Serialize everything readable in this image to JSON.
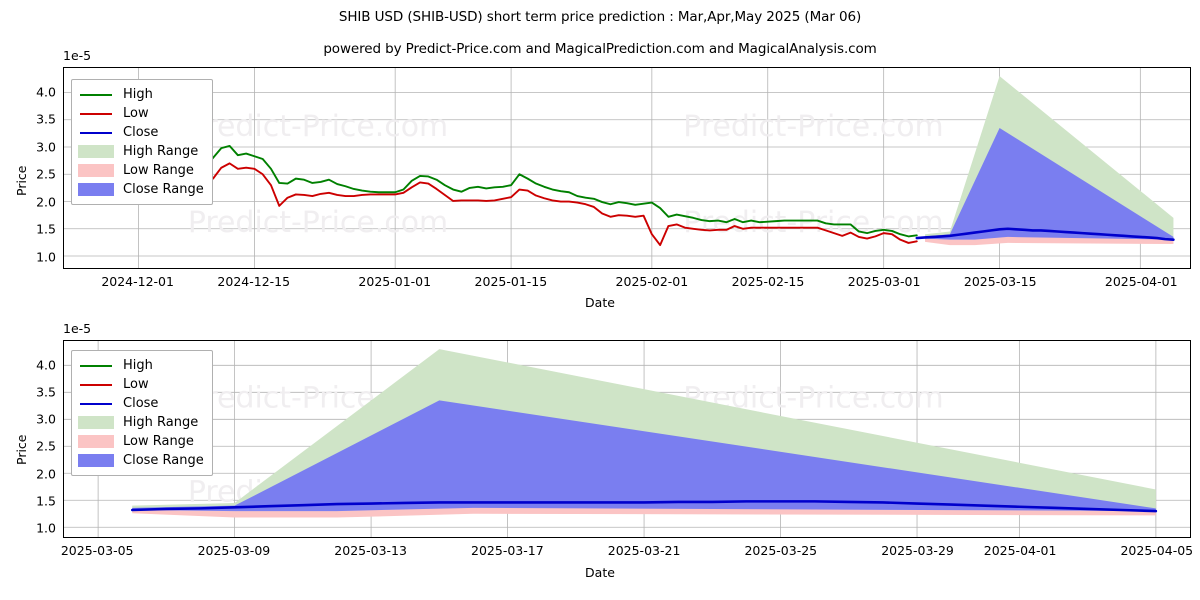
{
  "header": {
    "title": "SHIB USD (SHIB-USD) short term price prediction : Mar,Apr,May 2025 (Mar 06)",
    "subtitle": "powered by Predict-Price.com and MagicalPrediction.com and MagicalAnalysis.com"
  },
  "watermark": {
    "text": "Predict-Price.com"
  },
  "colors": {
    "high_line": "#008000",
    "low_line": "#cc0000",
    "close_line": "#0000cc",
    "high_range": "#cfe4c7",
    "low_range": "#fbc4c4",
    "close_range": "#7a7ef0",
    "grid": "#b4b4b4",
    "frame": "#000000",
    "watermark": "#f0eef0"
  },
  "legend": {
    "items": [
      {
        "label": "High",
        "type": "line",
        "color": "#008000",
        "name": "legend-high"
      },
      {
        "label": "Low",
        "type": "line",
        "color": "#cc0000",
        "name": "legend-low"
      },
      {
        "label": "Close",
        "type": "line",
        "color": "#0000cc",
        "name": "legend-close"
      },
      {
        "label": "High Range",
        "type": "patch",
        "color": "#cfe4c7",
        "name": "legend-high-range"
      },
      {
        "label": "Low Range",
        "type": "patch",
        "color": "#fbc4c4",
        "name": "legend-low-range"
      },
      {
        "label": "Close Range",
        "type": "patch",
        "color": "#7a7ef0",
        "name": "legend-close-range"
      }
    ]
  },
  "chart_data": [
    {
      "id": "top",
      "type": "line",
      "title": "SHIB USD (SHIB-USD) short term price prediction : Mar,Apr,May 2025 (Mar 06)",
      "xlabel": "Date",
      "ylabel": "Price",
      "y_exponent_label": "1e-5",
      "y_scale": 1e-05,
      "ylim": [
        0.78,
        4.45
      ],
      "yticks": [
        1.0,
        1.5,
        2.0,
        2.5,
        3.0,
        3.5,
        4.0
      ],
      "ytick_labels": [
        "1.0",
        "1.5",
        "2.0",
        "2.5",
        "3.0",
        "3.5",
        "4.0"
      ],
      "xlim": [
        "2024-11-22",
        "2025-04-07"
      ],
      "xticks": [
        "2024-12-01",
        "2024-12-15",
        "2025-01-01",
        "2025-01-15",
        "2025-02-01",
        "2025-02-15",
        "2025-03-01",
        "2025-03-15",
        "2025-04-01"
      ],
      "grid": true,
      "legend_position": "upper left",
      "series": [
        {
          "name": "High",
          "color": "#008000",
          "x": [
            "2024-11-25",
            "2024-11-26",
            "2024-11-27",
            "2024-11-28",
            "2024-11-29",
            "2024-11-30",
            "2024-12-01",
            "2024-12-02",
            "2024-12-03",
            "2024-12-04",
            "2024-12-05",
            "2024-12-06",
            "2024-12-07",
            "2024-12-08",
            "2024-12-09",
            "2024-12-10",
            "2024-12-11",
            "2024-12-12",
            "2024-12-13",
            "2024-12-14",
            "2024-12-15",
            "2024-12-16",
            "2024-12-17",
            "2024-12-18",
            "2024-12-19",
            "2024-12-20",
            "2024-12-21",
            "2024-12-22",
            "2024-12-23",
            "2024-12-24",
            "2024-12-25",
            "2024-12-26",
            "2024-12-27",
            "2024-12-28",
            "2024-12-29",
            "2024-12-30",
            "2024-12-31",
            "2025-01-01",
            "2025-01-02",
            "2025-01-03",
            "2025-01-04",
            "2025-01-05",
            "2025-01-06",
            "2025-01-07",
            "2025-01-08",
            "2025-01-09",
            "2025-01-10",
            "2025-01-11",
            "2025-01-12",
            "2025-01-13",
            "2025-01-14",
            "2025-01-15",
            "2025-01-16",
            "2025-01-17",
            "2025-01-18",
            "2025-01-19",
            "2025-01-20",
            "2025-01-21",
            "2025-01-22",
            "2025-01-23",
            "2025-01-24",
            "2025-01-25",
            "2025-01-26",
            "2025-01-27",
            "2025-01-28",
            "2025-01-29",
            "2025-01-30",
            "2025-01-31",
            "2025-02-01",
            "2025-02-02",
            "2025-02-03",
            "2025-02-04",
            "2025-02-05",
            "2025-02-06",
            "2025-02-07",
            "2025-02-08",
            "2025-02-09",
            "2025-02-10",
            "2025-02-11",
            "2025-02-12",
            "2025-02-13",
            "2025-02-14",
            "2025-02-15",
            "2025-02-16",
            "2025-02-17",
            "2025-02-18",
            "2025-02-19",
            "2025-02-20",
            "2025-02-21",
            "2025-02-22",
            "2025-02-23",
            "2025-02-24",
            "2025-02-25",
            "2025-02-26",
            "2025-02-27",
            "2025-02-28",
            "2025-03-01",
            "2025-03-02",
            "2025-03-03",
            "2025-03-04",
            "2025-03-05"
          ],
          "values": [
            2.3,
            2.45,
            2.6,
            2.75,
            2.85,
            2.8,
            2.95,
            3.05,
            2.95,
            3.05,
            2.95,
            3.05,
            3.1,
            3.05,
            2.62,
            2.8,
            2.98,
            3.02,
            2.85,
            2.88,
            2.83,
            2.78,
            2.6,
            2.34,
            2.33,
            2.42,
            2.4,
            2.34,
            2.36,
            2.4,
            2.32,
            2.28,
            2.23,
            2.2,
            2.18,
            2.17,
            2.17,
            2.17,
            2.22,
            2.38,
            2.47,
            2.46,
            2.4,
            2.3,
            2.22,
            2.18,
            2.25,
            2.27,
            2.24,
            2.26,
            2.27,
            2.3,
            2.5,
            2.42,
            2.33,
            2.27,
            2.22,
            2.19,
            2.17,
            2.1,
            2.07,
            2.05,
            1.99,
            1.95,
            1.99,
            1.97,
            1.94,
            1.96,
            1.98,
            1.88,
            1.72,
            1.76,
            1.73,
            1.7,
            1.66,
            1.64,
            1.65,
            1.62,
            1.68,
            1.62,
            1.65,
            1.62,
            1.63,
            1.64,
            1.65,
            1.65,
            1.65,
            1.65,
            1.65,
            1.6,
            1.58,
            1.58,
            1.58,
            1.45,
            1.42,
            1.46,
            1.48,
            1.46,
            1.4,
            1.36,
            1.38,
            1.4
          ]
        },
        {
          "name": "Low",
          "color": "#cc0000",
          "x": [
            "2024-11-25",
            "2024-11-26",
            "2024-11-27",
            "2024-11-28",
            "2024-11-29",
            "2024-11-30",
            "2024-12-01",
            "2024-12-02",
            "2024-12-03",
            "2024-12-04",
            "2024-12-05",
            "2024-12-06",
            "2024-12-07",
            "2024-12-08",
            "2024-12-09",
            "2024-12-10",
            "2024-12-11",
            "2024-12-12",
            "2024-12-13",
            "2024-12-14",
            "2024-12-15",
            "2024-12-16",
            "2024-12-17",
            "2024-12-18",
            "2024-12-19",
            "2024-12-20",
            "2024-12-21",
            "2024-12-22",
            "2024-12-23",
            "2024-12-24",
            "2024-12-25",
            "2024-12-26",
            "2024-12-27",
            "2024-12-28",
            "2024-12-29",
            "2024-12-30",
            "2024-12-31",
            "2025-01-01",
            "2025-01-02",
            "2025-01-03",
            "2025-01-04",
            "2025-01-05",
            "2025-01-06",
            "2025-01-07",
            "2025-01-08",
            "2025-01-09",
            "2025-01-10",
            "2025-01-11",
            "2025-01-12",
            "2025-01-13",
            "2025-01-14",
            "2025-01-15",
            "2025-01-16",
            "2025-01-17",
            "2025-01-18",
            "2025-01-19",
            "2025-01-20",
            "2025-01-21",
            "2025-01-22",
            "2025-01-23",
            "2025-01-24",
            "2025-01-25",
            "2025-01-26",
            "2025-01-27",
            "2025-01-28",
            "2025-01-29",
            "2025-01-30",
            "2025-01-31",
            "2025-02-01",
            "2025-02-02",
            "2025-02-03",
            "2025-02-04",
            "2025-02-05",
            "2025-02-06",
            "2025-02-07",
            "2025-02-08",
            "2025-02-09",
            "2025-02-10",
            "2025-02-11",
            "2025-02-12",
            "2025-02-13",
            "2025-02-14",
            "2025-02-15",
            "2025-02-16",
            "2025-02-17",
            "2025-02-18",
            "2025-02-19",
            "2025-02-20",
            "2025-02-21",
            "2025-02-22",
            "2025-02-23",
            "2025-02-24",
            "2025-02-25",
            "2025-02-26",
            "2025-02-27",
            "2025-02-28",
            "2025-03-01",
            "2025-03-02",
            "2025-03-03",
            "2025-03-04",
            "2025-03-05"
          ],
          "values": [
            2.0,
            2.12,
            2.22,
            2.4,
            2.52,
            2.48,
            2.58,
            2.78,
            2.64,
            2.75,
            2.68,
            2.76,
            2.92,
            2.62,
            2.38,
            2.42,
            2.62,
            2.7,
            2.6,
            2.62,
            2.6,
            2.5,
            2.3,
            1.92,
            2.07,
            2.13,
            2.12,
            2.1,
            2.14,
            2.16,
            2.12,
            2.1,
            2.1,
            2.12,
            2.13,
            2.13,
            2.13,
            2.13,
            2.16,
            2.26,
            2.35,
            2.33,
            2.23,
            2.12,
            2.01,
            2.02,
            2.02,
            2.02,
            2.01,
            2.02,
            2.05,
            2.08,
            2.22,
            2.2,
            2.11,
            2.06,
            2.02,
            2.0,
            2.0,
            1.98,
            1.95,
            1.9,
            1.78,
            1.72,
            1.75,
            1.74,
            1.72,
            1.74,
            1.4,
            1.2,
            1.55,
            1.58,
            1.52,
            1.5,
            1.48,
            1.47,
            1.48,
            1.48,
            1.55,
            1.5,
            1.52,
            1.52,
            1.52,
            1.52,
            1.52,
            1.52,
            1.52,
            1.52,
            1.52,
            1.47,
            1.42,
            1.37,
            1.43,
            1.35,
            1.32,
            1.36,
            1.42,
            1.4,
            1.3,
            1.24,
            1.27,
            1.35
          ]
        },
        {
          "name": "Close",
          "color": "#0000cc",
          "x": [
            "2025-03-05",
            "2025-03-06",
            "2025-03-07",
            "2025-03-08",
            "2025-03-09",
            "2025-03-10",
            "2025-03-11",
            "2025-03-12",
            "2025-03-13",
            "2025-03-14",
            "2025-03-15",
            "2025-03-16",
            "2025-03-17",
            "2025-03-18",
            "2025-03-19",
            "2025-03-20",
            "2025-03-21",
            "2025-03-22",
            "2025-03-23",
            "2025-03-24",
            "2025-03-25",
            "2025-03-26",
            "2025-03-27",
            "2025-03-28",
            "2025-03-29",
            "2025-03-30",
            "2025-03-31",
            "2025-04-01",
            "2025-04-02",
            "2025-04-03",
            "2025-04-04",
            "2025-04-05"
          ],
          "values": [
            1.33,
            1.34,
            1.35,
            1.36,
            1.37,
            1.39,
            1.41,
            1.43,
            1.45,
            1.47,
            1.49,
            1.5,
            1.49,
            1.48,
            1.47,
            1.47,
            1.46,
            1.45,
            1.44,
            1.43,
            1.42,
            1.41,
            1.4,
            1.39,
            1.38,
            1.37,
            1.36,
            1.35,
            1.34,
            1.33,
            1.31,
            1.3
          ]
        }
      ],
      "bands": [
        {
          "name": "High Range",
          "color": "#cfe4c7",
          "x": [
            "2025-03-06",
            "2025-03-09",
            "2025-03-15",
            "2025-04-05"
          ],
          "upper": [
            1.4,
            1.45,
            4.3,
            1.7
          ],
          "lower": [
            1.32,
            1.33,
            1.38,
            1.3
          ]
        },
        {
          "name": "Close Range",
          "color": "#7a7ef0",
          "x": [
            "2025-03-06",
            "2025-03-09",
            "2025-03-15",
            "2025-04-05"
          ],
          "upper": [
            1.36,
            1.4,
            3.35,
            1.35
          ],
          "lower": [
            1.3,
            1.28,
            1.3,
            1.27
          ]
        },
        {
          "name": "Low Range",
          "color": "#fbc4c4",
          "x": [
            "2025-03-06",
            "2025-03-09",
            "2025-03-12",
            "2025-03-16",
            "2025-04-05"
          ],
          "upper": [
            1.32,
            1.3,
            1.3,
            1.35,
            1.3
          ],
          "lower": [
            1.26,
            1.2,
            1.2,
            1.24,
            1.22
          ]
        }
      ]
    },
    {
      "id": "bottom",
      "type": "line",
      "title": "",
      "xlabel": "Date",
      "ylabel": "Price",
      "y_exponent_label": "1e-5",
      "y_scale": 1e-05,
      "ylim": [
        0.82,
        4.45
      ],
      "yticks": [
        1.0,
        1.5,
        2.0,
        2.5,
        3.0,
        3.5,
        4.0
      ],
      "ytick_labels": [
        "1.0",
        "1.5",
        "2.0",
        "2.5",
        "3.0",
        "3.5",
        "4.0"
      ],
      "xlim": [
        "2025-03-04",
        "2025-04-06"
      ],
      "xticks": [
        "2025-03-05",
        "2025-03-09",
        "2025-03-13",
        "2025-03-17",
        "2025-03-21",
        "2025-03-25",
        "2025-03-29",
        "2025-04-01",
        "2025-04-05"
      ],
      "grid": true,
      "legend_position": "upper left",
      "series": [
        {
          "name": "Close",
          "color": "#0000cc",
          "x": [
            "2025-03-06",
            "2025-03-07",
            "2025-03-08",
            "2025-03-09",
            "2025-03-10",
            "2025-03-11",
            "2025-03-12",
            "2025-03-13",
            "2025-03-14",
            "2025-03-15",
            "2025-03-16",
            "2025-03-17",
            "2025-03-18",
            "2025-03-19",
            "2025-03-20",
            "2025-03-21",
            "2025-03-22",
            "2025-03-23",
            "2025-03-24",
            "2025-03-25",
            "2025-03-26",
            "2025-03-27",
            "2025-03-28",
            "2025-03-29",
            "2025-03-30",
            "2025-03-31",
            "2025-04-01",
            "2025-04-02",
            "2025-04-03",
            "2025-04-04",
            "2025-04-05"
          ],
          "values": [
            1.32,
            1.34,
            1.35,
            1.37,
            1.39,
            1.41,
            1.43,
            1.44,
            1.45,
            1.46,
            1.46,
            1.46,
            1.46,
            1.46,
            1.46,
            1.46,
            1.47,
            1.47,
            1.48,
            1.48,
            1.48,
            1.47,
            1.46,
            1.44,
            1.42,
            1.4,
            1.38,
            1.36,
            1.34,
            1.32,
            1.3
          ]
        }
      ],
      "bands": [
        {
          "name": "High Range",
          "color": "#cfe4c7",
          "x": [
            "2025-03-06",
            "2025-03-09",
            "2025-03-15",
            "2025-04-05"
          ],
          "upper": [
            1.4,
            1.45,
            4.3,
            1.7
          ],
          "lower": [
            1.32,
            1.33,
            1.38,
            1.3
          ]
        },
        {
          "name": "Close Range",
          "color": "#7a7ef0",
          "x": [
            "2025-03-06",
            "2025-03-09",
            "2025-03-15",
            "2025-04-05"
          ],
          "upper": [
            1.36,
            1.4,
            3.35,
            1.35
          ],
          "lower": [
            1.29,
            1.27,
            1.29,
            1.27
          ]
        },
        {
          "name": "Low Range",
          "color": "#fbc4c4",
          "x": [
            "2025-03-06",
            "2025-03-09",
            "2025-03-12",
            "2025-03-16",
            "2025-04-05"
          ],
          "upper": [
            1.32,
            1.3,
            1.3,
            1.36,
            1.3
          ],
          "lower": [
            1.26,
            1.18,
            1.18,
            1.25,
            1.22
          ]
        }
      ]
    }
  ]
}
